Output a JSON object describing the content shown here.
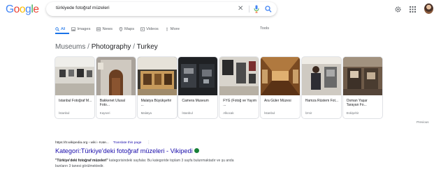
{
  "header": {
    "logo": "Google",
    "logo_colors": [
      "#4285f4",
      "#ea4335",
      "#fbbc05",
      "#4285f4",
      "#34a853",
      "#ea4335"
    ],
    "query": "türkiyede fotoğraf müzeleri",
    "clear_icon": "close-icon",
    "mic_icon": "mic-icon",
    "search_icon": "search-icon",
    "settings_icon": "gear-icon",
    "apps_icon": "apps-grid-icon"
  },
  "tabs": [
    {
      "label": "All",
      "icon": "search-icon",
      "active": true
    },
    {
      "label": "Images",
      "icon": "image-icon",
      "active": false
    },
    {
      "label": "News",
      "icon": "news-icon",
      "active": false
    },
    {
      "label": "Maps",
      "icon": "map-pin-icon",
      "active": false
    },
    {
      "label": "Videos",
      "icon": "video-icon",
      "active": false
    },
    {
      "label": "More",
      "icon": "more-icon",
      "active": false
    }
  ],
  "tools_label": "Tools",
  "breadcrumb": {
    "first": "Museums",
    "sep1": " / ",
    "second": "Photography",
    "sep2": " / ",
    "third": "Turkey"
  },
  "carousel": [
    {
      "name": "Istanbul Fotoğraf M...",
      "loc": "İstanbul"
    },
    {
      "name": "Bakkenet Ulusal Foto...",
      "loc": "Kayseri"
    },
    {
      "name": "Malatya Büyükşehir ...",
      "loc": "Malatya"
    },
    {
      "name": "Camera Museum",
      "loc": "İstanbul"
    },
    {
      "name": "FYG (Fotoğ ve Yayım ...",
      "loc": "Alkocak"
    },
    {
      "name": "Ara Güler Müzesi",
      "loc": "İstanbul"
    },
    {
      "name": "Hamza Rüstem Fot...",
      "loc": "İzmir"
    },
    {
      "name": "Osman Yaşar Tarayan Fo...",
      "loc": "Eskişehir"
    }
  ],
  "more_label": "Previous",
  "result": {
    "url": "https://tr.wikipedia.org › wiki › Kate...",
    "translate": "Translate this page",
    "menu": "⋮",
    "title": "Kategori:Türkiye'deki fotoğraf müzeleri - Vikipedi",
    "snippet_bold": "\"Türkiye'deki fotoğraf müzeleri\"",
    "snippet_rest": " kategorisindeki sayfalar. Bu kategoride toplam 3 sayfa bulunmaktadır ve şu anda bunların 3 tanesi görülmektedir.",
    "verified_color": "#188038"
  }
}
